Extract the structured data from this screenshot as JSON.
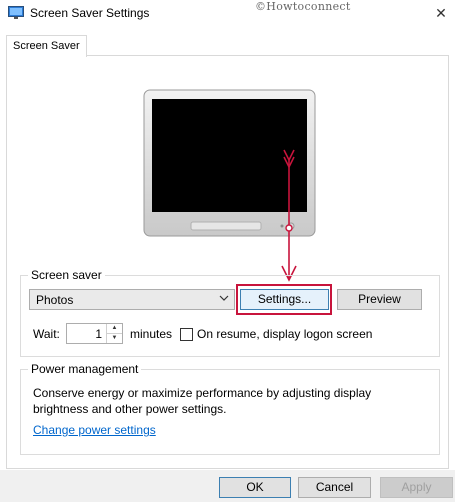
{
  "window": {
    "title": "Screen Saver Settings",
    "watermark": "©Howtoconnect",
    "close_glyph": "✕"
  },
  "tabs": [
    {
      "label": "Screen Saver"
    }
  ],
  "screen_saver": {
    "group_label": "Screen saver",
    "selected": "Photos",
    "settings_label": "Settings...",
    "preview_label": "Preview",
    "wait_label": "Wait:",
    "wait_value": "1",
    "minutes_label": "minutes",
    "resume_label": "On resume, display logon screen"
  },
  "power": {
    "group_label": "Power management",
    "description": "Conserve energy or maximize performance by adjusting display brightness and other power settings.",
    "link_label": "Change power settings"
  },
  "buttons": {
    "ok": "OK",
    "cancel": "Cancel",
    "apply": "Apply"
  },
  "colors": {
    "highlight": "#c8143c",
    "link": "#0066cc",
    "focus_border": "#3c7fb1"
  },
  "icons": {
    "app": "monitor-icon",
    "close": "close-icon",
    "dropdown": "chevron-down-icon",
    "spin_up": "triangle-up-icon",
    "spin_down": "triangle-down-icon"
  }
}
